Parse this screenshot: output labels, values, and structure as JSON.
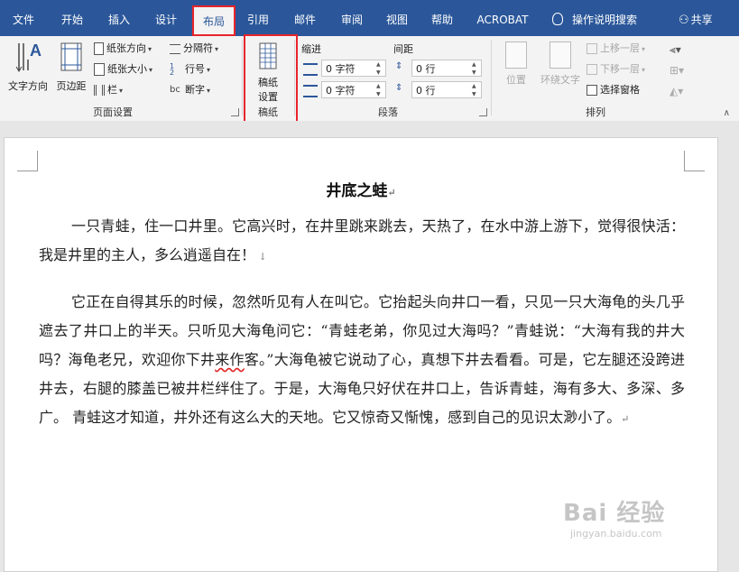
{
  "tabs": [
    {
      "label": "文件"
    },
    {
      "label": "开始"
    },
    {
      "label": "插入"
    },
    {
      "label": "设计"
    },
    {
      "label": "布局"
    },
    {
      "label": "引用"
    },
    {
      "label": "邮件"
    },
    {
      "label": "审阅"
    },
    {
      "label": "视图"
    },
    {
      "label": "帮助"
    },
    {
      "label": "ACROBAT"
    }
  ],
  "tell_me": "操作说明搜索",
  "share": "共享",
  "ribbon": {
    "page_setup": {
      "label": "页面设置",
      "text_direction": "文字方向",
      "margins": "页边距",
      "orientation": "纸张方向",
      "size": "纸张大小",
      "columns": "栏",
      "breaks": "分隔符",
      "line_numbers": "行号",
      "hyphenation": "断字"
    },
    "draft_paper": {
      "label": "稿纸",
      "button_line1": "稿纸",
      "button_line2": "设置"
    },
    "paragraph": {
      "label": "段落",
      "indent_label": "缩进",
      "spacing_label": "间距",
      "indent_left": "0 字符",
      "indent_right": "0 字符",
      "spacing_before": "0 行",
      "spacing_after": "0 行"
    },
    "arrange": {
      "label": "排列",
      "position": "位置",
      "wrap_text": "环绕文字",
      "bring_forward": "上移一层",
      "send_backward": "下移一层",
      "selection_pane": "选择窗格"
    }
  },
  "document": {
    "title": "井底之蛙",
    "para1": "一只青蛙，住一口井里。它高兴时，在井里跳来跳去，天热了，在水中游上游下，觉得很快活：我是井里的主人，多么逍遥自在！",
    "para2_a": "它正在自得其乐的时候，忽然听见有人在叫它。它抬起头向井口一看，只见一只大海龟的头几乎遮去了井口上的半天。只听见大海龟问它：“青蛙老弟，你见过大海吗？”青蛙说：“大海有我的井大吗？海龟老兄，欢迎你下井",
    "para2_squig": "来作",
    "para2_b": "客。”大海龟被它说动了心，真想下井去看看。可是，它左腿还没跨进井去，右腿的膝盖已被井栏绊住了。于是，大海龟只好伏在井口上，告诉青蛙，海有多大、多深、多广。 青蛙这才知道，井外还有这么大的天地。它又惊奇又惭愧，感到自己的见识太渺小了。"
  },
  "watermark": {
    "brand": "Bai 经验",
    "url": "jingyan.baidu.com"
  },
  "colors": {
    "tabbar": "#2b579a",
    "ribbon": "#f3f3f3",
    "highlight": "#e8252b"
  }
}
